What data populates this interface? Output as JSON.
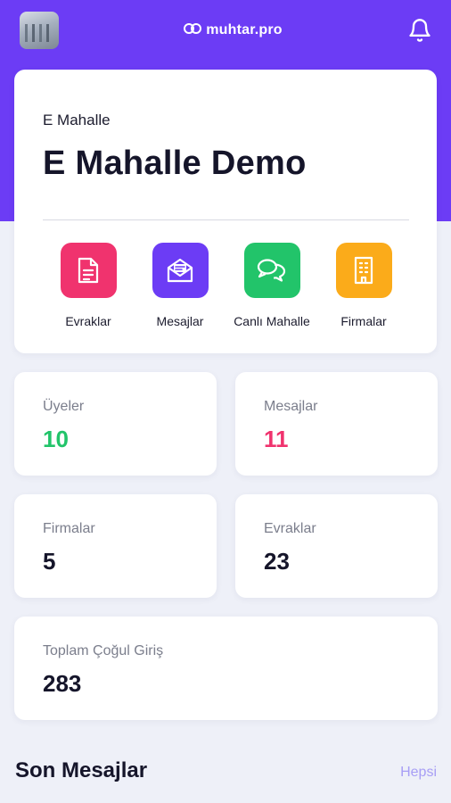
{
  "colors": {
    "header": "#6c3cf5",
    "background": "#eef0f8",
    "documents_tile": "#f0336e",
    "messages_tile": "#6c3cf5",
    "live_tile": "#22c46a",
    "companies_tile": "#fbab1a",
    "members_value": "#22c46a",
    "messages_value": "#f0336e"
  },
  "topbar": {
    "brand": "muhtar.pro",
    "avatar_icon": "profile-photo",
    "brand_icon": "infinity-logo-icon",
    "notification_icon": "bell-icon"
  },
  "main": {
    "subtitle": "E Mahalle",
    "title": "E Mahalle Demo",
    "actions": [
      {
        "label": "Evraklar",
        "icon": "document-icon"
      },
      {
        "label": "Mesajlar",
        "icon": "mail-icon"
      },
      {
        "label": "Canlı Mahalle",
        "icon": "chat-bubbles-icon"
      },
      {
        "label": "Firmalar",
        "icon": "building-icon"
      }
    ]
  },
  "stats": {
    "members": {
      "label": "Üyeler",
      "value": "10"
    },
    "messages": {
      "label": "Mesajlar",
      "value": "11"
    },
    "companies": {
      "label": "Firmalar",
      "value": "5"
    },
    "documents": {
      "label": "Evraklar",
      "value": "23"
    },
    "total_logins": {
      "label": "Toplam Çoğul Giriş",
      "value": "283"
    }
  },
  "recent": {
    "title": "Son Mesajlar",
    "link": "Hepsi"
  }
}
